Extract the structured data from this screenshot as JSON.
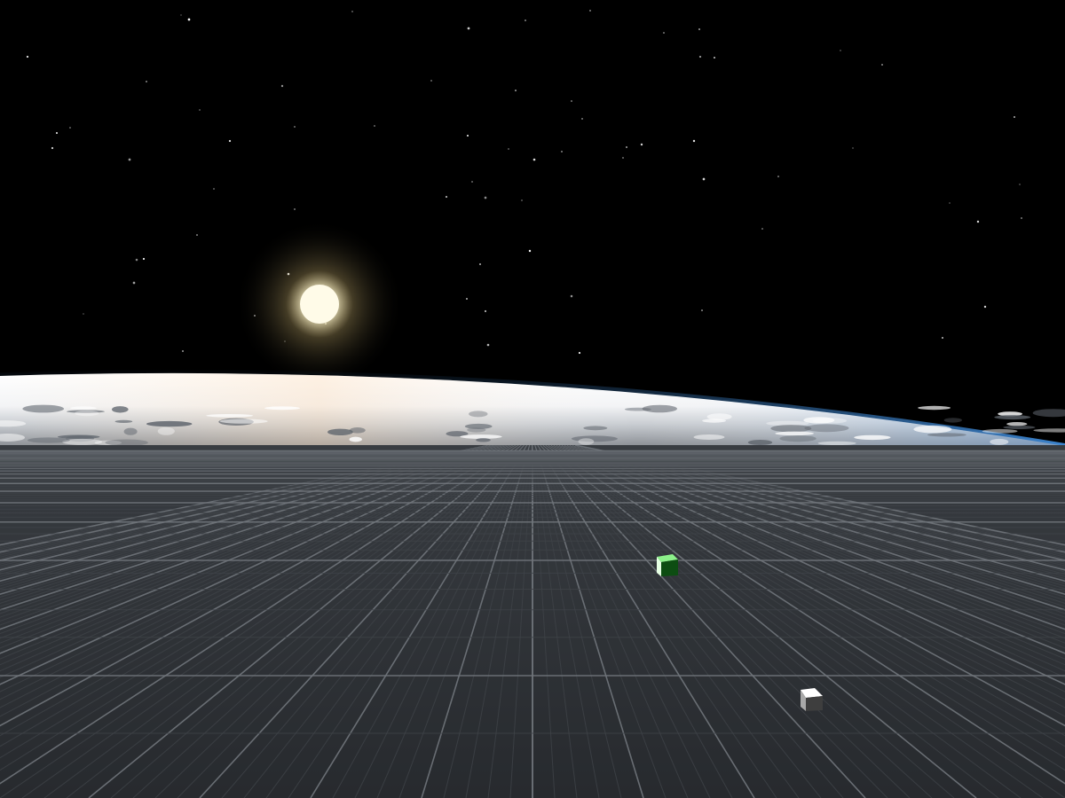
{
  "scene": {
    "sky": {
      "color": "#000000",
      "star_color": "#ffffff"
    },
    "sun": {
      "core_color": "#fffbe8",
      "glow_color": "#e8d9a0"
    },
    "planet": {
      "cloud_color": "#ffffff",
      "atmosphere_color": "#4aa3ff",
      "land_color": "#6d6a63"
    },
    "ground": {
      "base_color": "#2c2f33",
      "grid_minor_color": "#3f4348",
      "grid_major_color": "#70757b"
    },
    "objects": [
      {
        "name": "green-cube",
        "top_color": "#8cf08a",
        "front_color": "#0d4d12",
        "side_color": "#e6ffe4"
      },
      {
        "name": "white-cube",
        "top_color": "#ffffff",
        "front_color": "#3e3e3e",
        "side_color": "#a8a8a8"
      }
    ]
  }
}
